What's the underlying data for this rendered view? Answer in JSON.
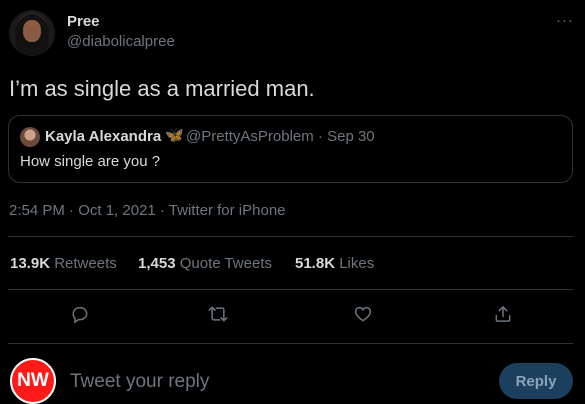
{
  "tweet": {
    "display_name": "Pree",
    "handle": "@diabolicalpree",
    "text": "I’m as single as a married man.",
    "more_label": "···",
    "avatar_icon": "profile-photo"
  },
  "quoted_tweet": {
    "display_name": "Kayla Alexandra",
    "badge_glyph": "🦋",
    "handle_and_date": "@PrettyAsProblem · Sep 30",
    "text": "How single are you ?"
  },
  "meta": {
    "text": "2:54 PM · Oct 1, 2021 · Twitter for iPhone"
  },
  "stats": [
    {
      "count": "13.9K",
      "label": "Retweets"
    },
    {
      "count": "1,453",
      "label": "Quote Tweets"
    },
    {
      "count": "51.8K",
      "label": "Likes"
    }
  ],
  "actions": [
    {
      "icon": "reply-icon"
    },
    {
      "icon": "retweet-icon"
    },
    {
      "icon": "like-icon"
    },
    {
      "icon": "share-icon"
    }
  ],
  "reply_bar": {
    "avatar_text": "NW",
    "placeholder": "Tweet your reply",
    "button_label": "Reply"
  },
  "colors": {
    "background": "#000000",
    "text": "#d9d9d9",
    "muted": "#6e767d",
    "border": "#2f3336",
    "reply_button": "#1d3f5e",
    "avatar_badge": "#ff1a1a"
  }
}
